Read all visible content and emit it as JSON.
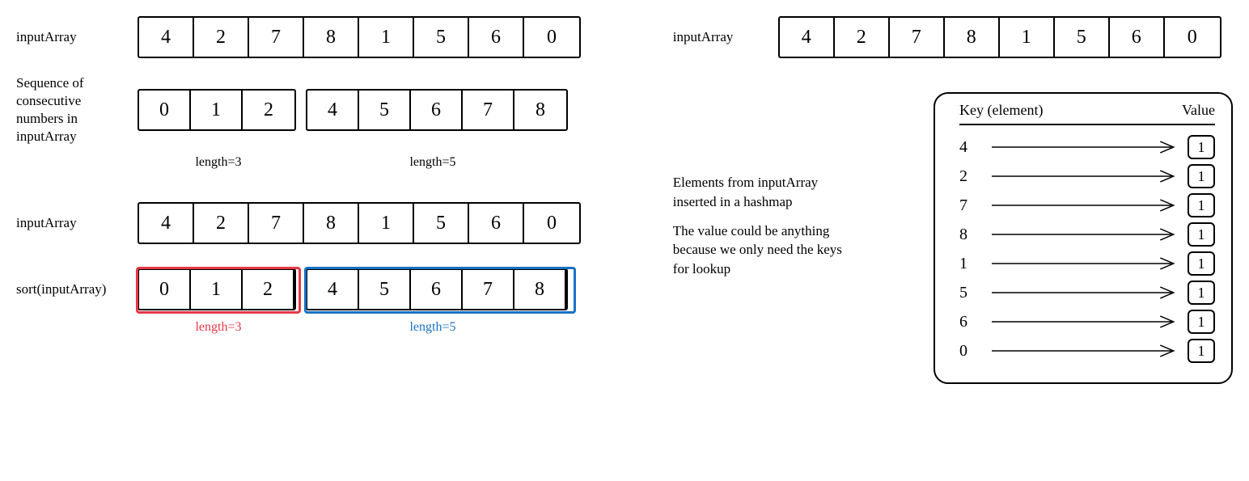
{
  "labels": {
    "inputArray": "inputArray",
    "sequences": "Sequence of consecutive numbers in inputArray",
    "sortInputArray": "sort(inputArray)",
    "hashmapCaption1": "Elements from inputArray inserted in a hashmap",
    "hashmapCaption2": "The value could be anything because we only need the keys for lookup",
    "keyHeader": "Key (element)",
    "valueHeader": "Value",
    "length3": "length=3",
    "length5": "length=5"
  },
  "arrays": {
    "input": [
      "4",
      "2",
      "7",
      "8",
      "1",
      "5",
      "6",
      "0"
    ],
    "seq1": [
      "0",
      "1",
      "2"
    ],
    "seq2": [
      "4",
      "5",
      "6",
      "7",
      "8"
    ],
    "sorted1": [
      "0",
      "1",
      "2"
    ],
    "sorted2": [
      "4",
      "5",
      "6",
      "7",
      "8"
    ]
  },
  "hashmap": [
    {
      "key": "4",
      "val": "1"
    },
    {
      "key": "2",
      "val": "1"
    },
    {
      "key": "7",
      "val": "1"
    },
    {
      "key": "8",
      "val": "1"
    },
    {
      "key": "1",
      "val": "1"
    },
    {
      "key": "5",
      "val": "1"
    },
    {
      "key": "6",
      "val": "1"
    },
    {
      "key": "0",
      "val": "1"
    }
  ]
}
